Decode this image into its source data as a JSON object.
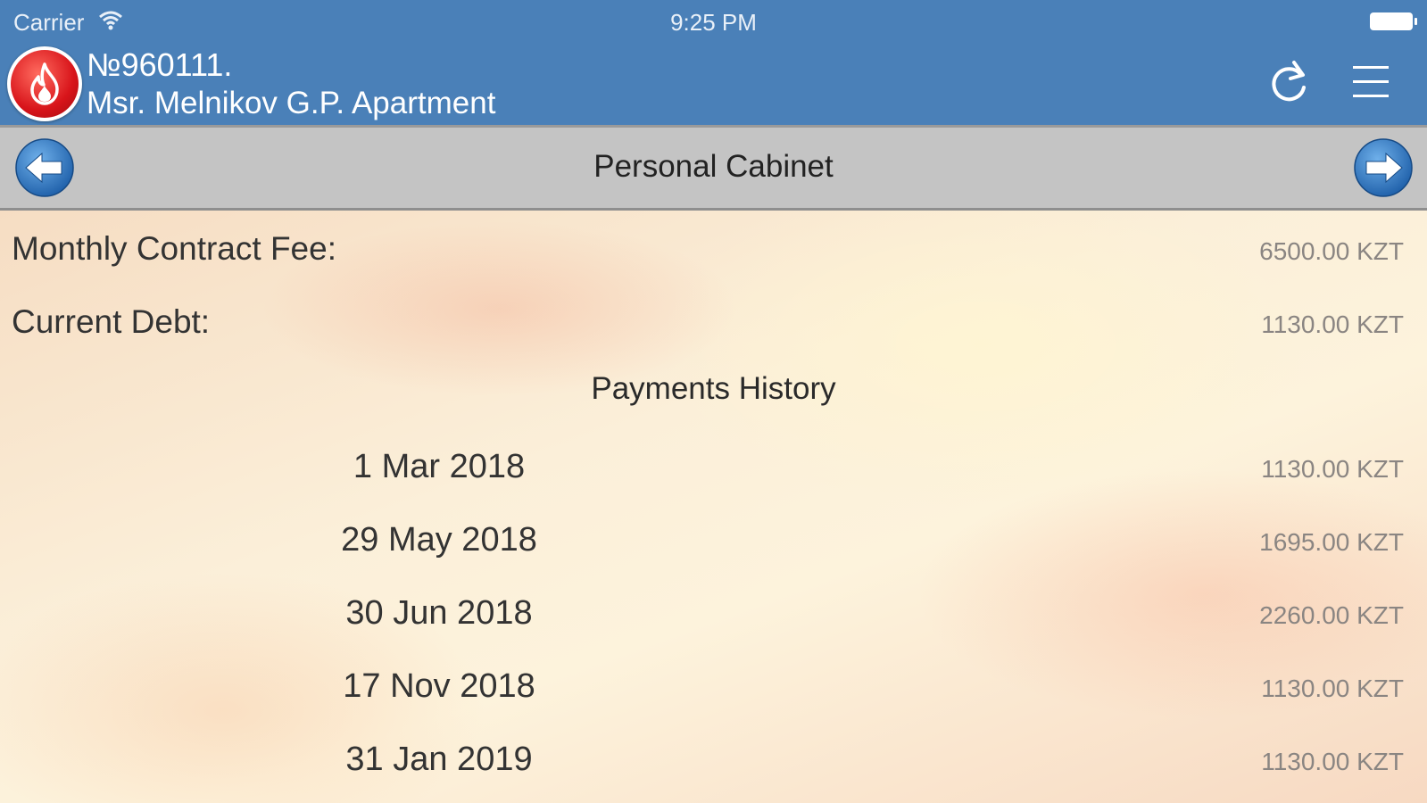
{
  "status_bar": {
    "carrier": "Carrier",
    "time": "9:25 PM",
    "wifi_icon": "wifi-icon",
    "battery_icon": "battery-icon"
  },
  "header": {
    "account_number": "№960111.",
    "account_name": "Msr. Melnikov G.P. Apartment",
    "logo_icon": "flame-logo-icon",
    "refresh_icon": "refresh-icon",
    "menu_icon": "menu-icon",
    "background_color": "#4a80b8"
  },
  "nav": {
    "title": "Personal Cabinet",
    "prev_icon": "arrow-left-icon",
    "next_icon": "arrow-right-icon"
  },
  "summary": {
    "monthly_fee_label": "Monthly Contract Fee:",
    "monthly_fee_value": "6500.00 KZT",
    "debt_label": "Current Debt:",
    "debt_value": "1130.00 KZT"
  },
  "history": {
    "title": "Payments History",
    "payments": [
      {
        "date": "1 Mar 2018",
        "amount": "1130.00 KZT"
      },
      {
        "date": "29 May 2018",
        "amount": "1695.00 KZT"
      },
      {
        "date": "30 Jun 2018",
        "amount": "2260.00 KZT"
      },
      {
        "date": "17 Nov 2018",
        "amount": "1130.00 KZT"
      },
      {
        "date": "31 Jan 2019",
        "amount": "1130.00 KZT"
      }
    ]
  }
}
